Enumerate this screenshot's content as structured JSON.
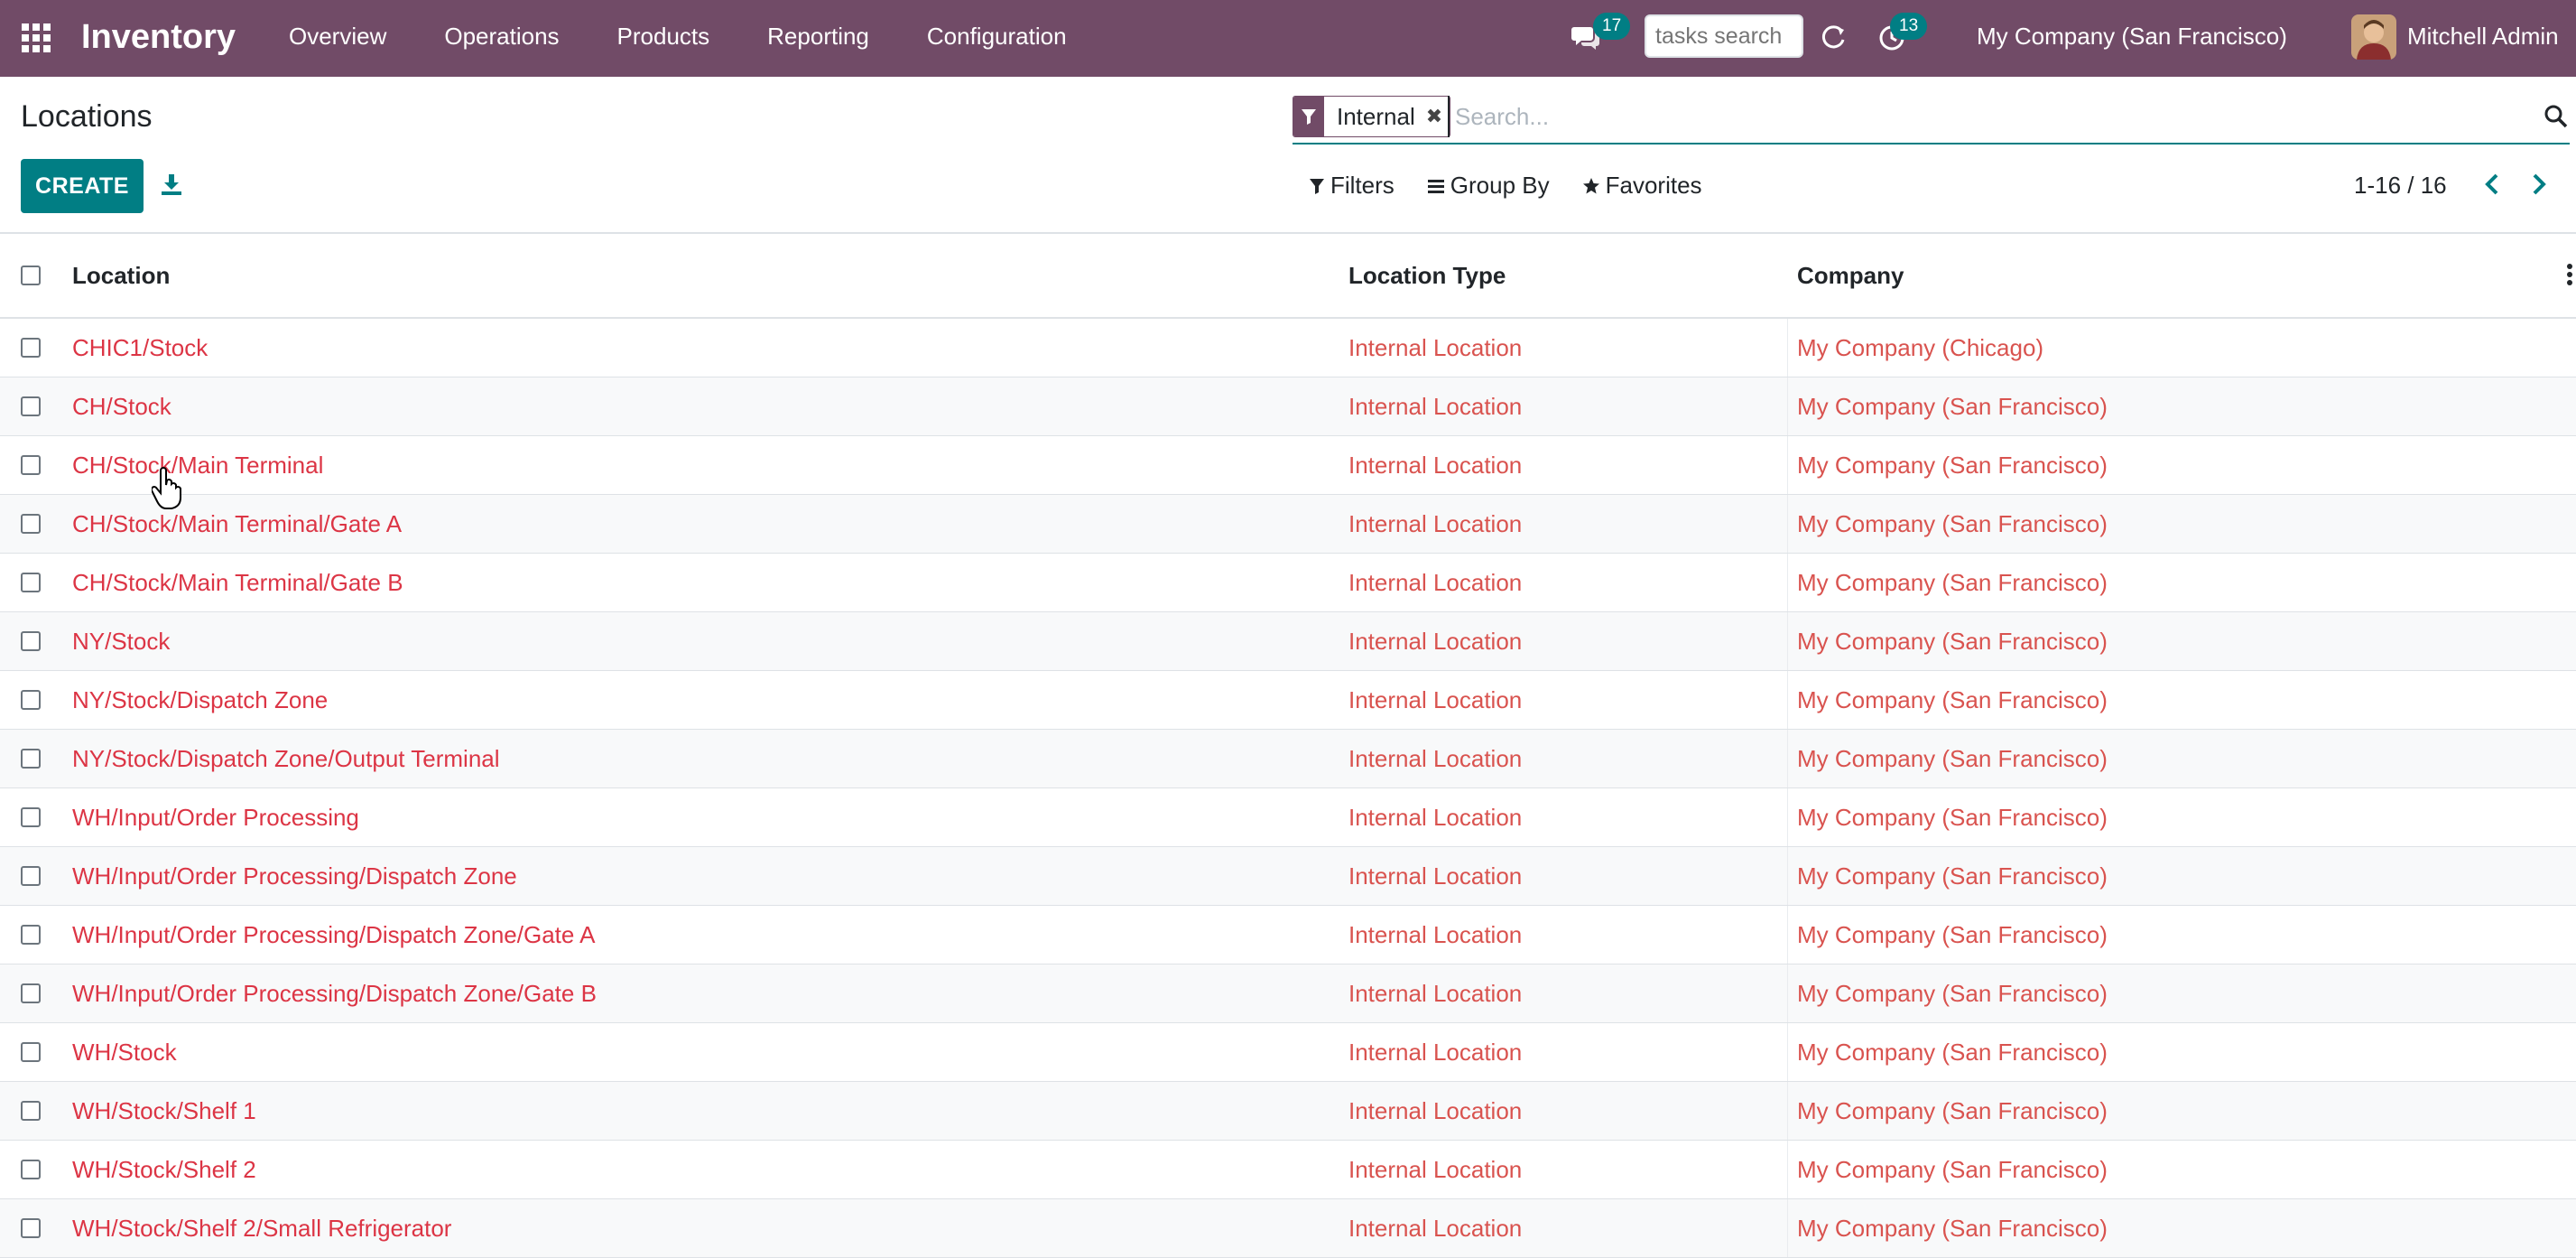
{
  "navbar": {
    "app_title": "Inventory",
    "menu": [
      "Overview",
      "Operations",
      "Products",
      "Reporting",
      "Configuration"
    ],
    "chat_badge": "17",
    "tasks_search_placeholder": "tasks search",
    "activity_badge": "13",
    "company": "My Company (San Francisco)",
    "user": "Mitchell Admin"
  },
  "control_panel": {
    "title": "Locations",
    "create_label": "CREATE",
    "facet_label": "Internal",
    "search_placeholder": "Search...",
    "filters_label": "Filters",
    "groupby_label": "Group By",
    "favorites_label": "Favorites",
    "pager": "1-16 / 16"
  },
  "colors": {
    "brand": "#714b67",
    "accent": "#017e84",
    "link": "#d9534f"
  },
  "table": {
    "headers": {
      "location": "Location",
      "type": "Location Type",
      "company": "Company"
    },
    "rows": [
      {
        "location": "CHIC1/Stock",
        "type": "Internal Location",
        "company": "My Company (Chicago)"
      },
      {
        "location": "CH/Stock",
        "type": "Internal Location",
        "company": "My Company (San Francisco)"
      },
      {
        "location": "CH/Stock/Main Terminal",
        "type": "Internal Location",
        "company": "My Company (San Francisco)"
      },
      {
        "location": "CH/Stock/Main Terminal/Gate A",
        "type": "Internal Location",
        "company": "My Company (San Francisco)"
      },
      {
        "location": "CH/Stock/Main Terminal/Gate B",
        "type": "Internal Location",
        "company": "My Company (San Francisco)"
      },
      {
        "location": "NY/Stock",
        "type": "Internal Location",
        "company": "My Company (San Francisco)"
      },
      {
        "location": "NY/Stock/Dispatch Zone",
        "type": "Internal Location",
        "company": "My Company (San Francisco)"
      },
      {
        "location": "NY/Stock/Dispatch Zone/Output Terminal",
        "type": "Internal Location",
        "company": "My Company (San Francisco)"
      },
      {
        "location": "WH/Input/Order Processing",
        "type": "Internal Location",
        "company": "My Company (San Francisco)"
      },
      {
        "location": "WH/Input/Order Processing/Dispatch Zone",
        "type": "Internal Location",
        "company": "My Company (San Francisco)"
      },
      {
        "location": "WH/Input/Order Processing/Dispatch Zone/Gate A",
        "type": "Internal Location",
        "company": "My Company (San Francisco)"
      },
      {
        "location": "WH/Input/Order Processing/Dispatch Zone/Gate B",
        "type": "Internal Location",
        "company": "My Company (San Francisco)"
      },
      {
        "location": "WH/Stock",
        "type": "Internal Location",
        "company": "My Company (San Francisco)"
      },
      {
        "location": "WH/Stock/Shelf 1",
        "type": "Internal Location",
        "company": "My Company (San Francisco)"
      },
      {
        "location": "WH/Stock/Shelf 2",
        "type": "Internal Location",
        "company": "My Company (San Francisco)"
      },
      {
        "location": "WH/Stock/Shelf 2/Small Refrigerator",
        "type": "Internal Location",
        "company": "My Company (San Francisco)"
      }
    ]
  }
}
